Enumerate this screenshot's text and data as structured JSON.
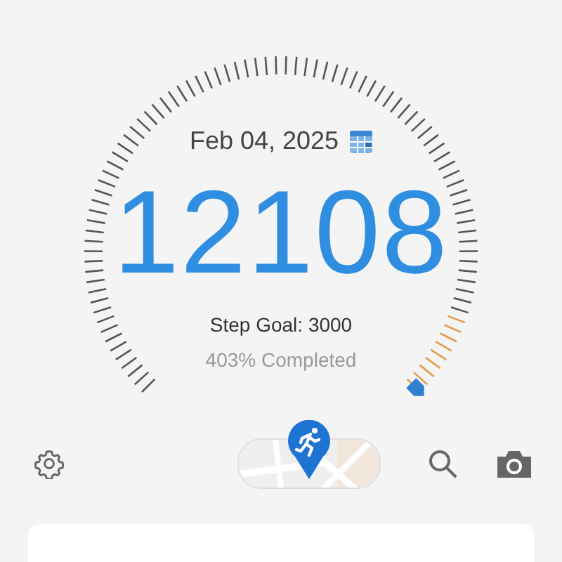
{
  "date": "Feb 04, 2025",
  "steps": "12108",
  "goal": "Step Goal: 3000",
  "completed": "403% Completed"
}
